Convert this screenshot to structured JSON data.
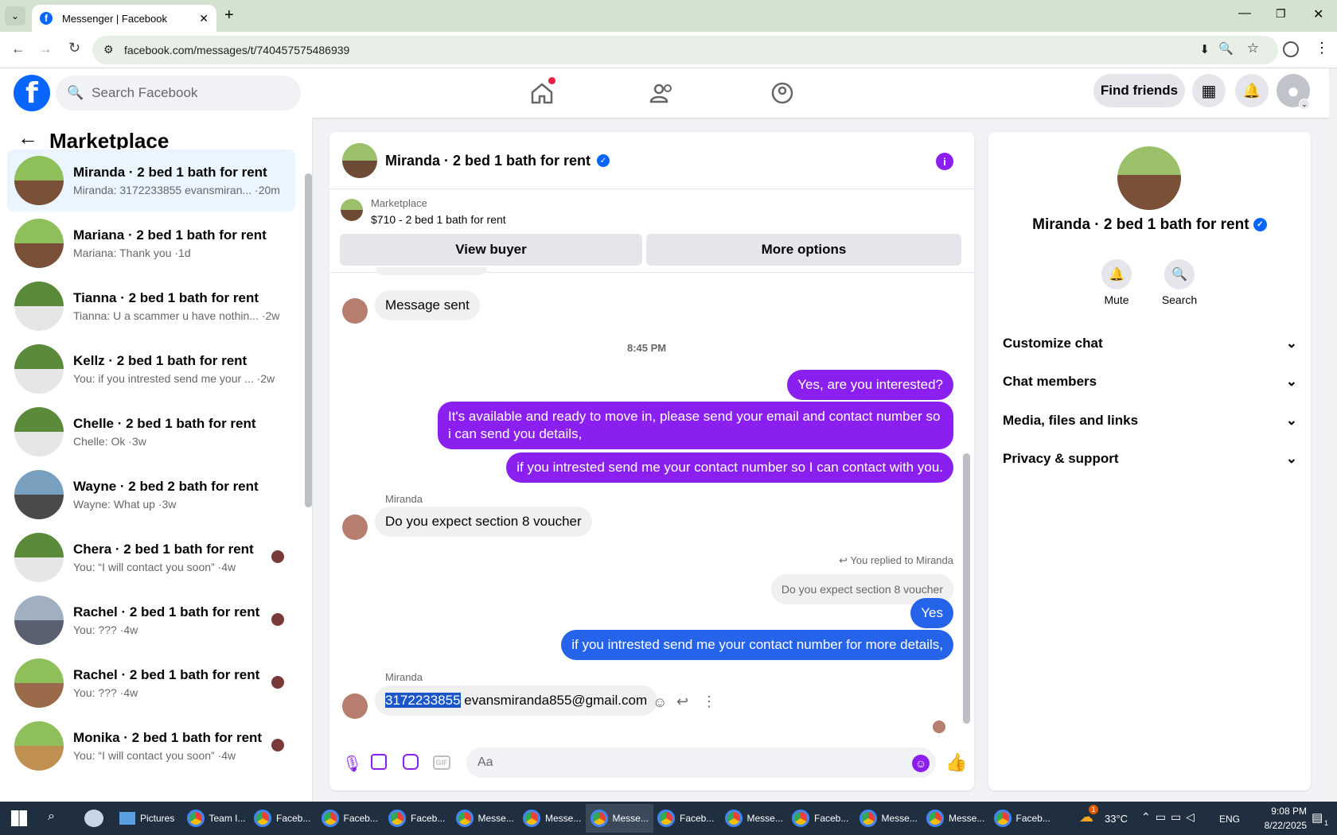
{
  "browser": {
    "tab_title": "Messenger | Facebook",
    "url": "facebook.com/messages/t/740457575486939"
  },
  "fb": {
    "search_placeholder": "Search Facebook",
    "find_friends": "Find friends"
  },
  "left": {
    "title": "Marketplace",
    "conversations": [
      {
        "name": "Miranda · 2 bed 1 bath for rent",
        "preview": "Miranda: 3172233855 evansmiran... ·20m"
      },
      {
        "name": "Mariana · 2 bed 1 bath for rent",
        "preview": "Mariana: Thank you ·1d"
      },
      {
        "name": "Tianna · 2 bed 1 bath for rent",
        "preview": "Tianna: U a scammer u have nothin... ·2w"
      },
      {
        "name": "Kellz · 2 bed 1 bath for rent",
        "preview": "You: if you intrested send me your ... ·2w"
      },
      {
        "name": "Chelle · 2 bed 1 bath for rent",
        "preview": "Chelle: Ok ·3w"
      },
      {
        "name": "Wayne · 2 bed 2 bath for rent",
        "preview": "Wayne: What up ·3w"
      },
      {
        "name": "Chera · 2 bed 1 bath for rent",
        "preview": "You: “I will contact you soon” ·4w"
      },
      {
        "name": "Rachel · 2 bed 1 bath for rent",
        "preview": "You: ??? ·4w"
      },
      {
        "name": "Rachel · 2 bed 1 bath for rent",
        "preview": "You: ??? ·4w"
      },
      {
        "name": "Monika · 2 bed 1 bath for rent",
        "preview": "You: “I will contact you soon” ·4w"
      }
    ]
  },
  "chat": {
    "title": "Miranda · 2 bed 1 bath for rent",
    "marketplace_label": "Marketplace",
    "listing": "$710 - 2 bed 1 bath for rent",
    "view_buyer": "View buyer",
    "more_options": "More options",
    "msg_sent": "Message sent",
    "time": "8:45 PM",
    "out1": "Yes, are you interested?",
    "out2": "It's available and ready to move in, please send your email and contact number so i can send you details,",
    "out3": "if you intrested send me your contact number so I can contact with you.",
    "sender": "Miranda",
    "in1": "Do you expect section 8 voucher",
    "replied": "You replied to Miranda",
    "quoted": "Do you expect section 8 voucher",
    "out4": "Yes",
    "out5": "if you intrested send me your contact number for more details,",
    "in2_phone": "3172233855",
    "in2_email": "evansmiranda855@gmail.com",
    "composer_placeholder": "Aa"
  },
  "info": {
    "name": "Miranda · 2 bed 1 bath for rent",
    "mute": "Mute",
    "search": "Search",
    "sections": [
      "Customize chat",
      "Chat members",
      "Media, files and links",
      "Privacy & support"
    ]
  },
  "taskbar": {
    "items": [
      "Pictures",
      "Team I...",
      "Faceb...",
      "Faceb...",
      "Faceb...",
      "Messe...",
      "Messe...",
      "Messe...",
      "Faceb...",
      "Messe...",
      "Faceb...",
      "Messe...",
      "Messe...",
      "Faceb..."
    ],
    "weather": "33°C",
    "weather_badge": "1",
    "lang": "ENG",
    "time": "9:08 PM",
    "date": "8/22/2025",
    "notif": "1"
  }
}
